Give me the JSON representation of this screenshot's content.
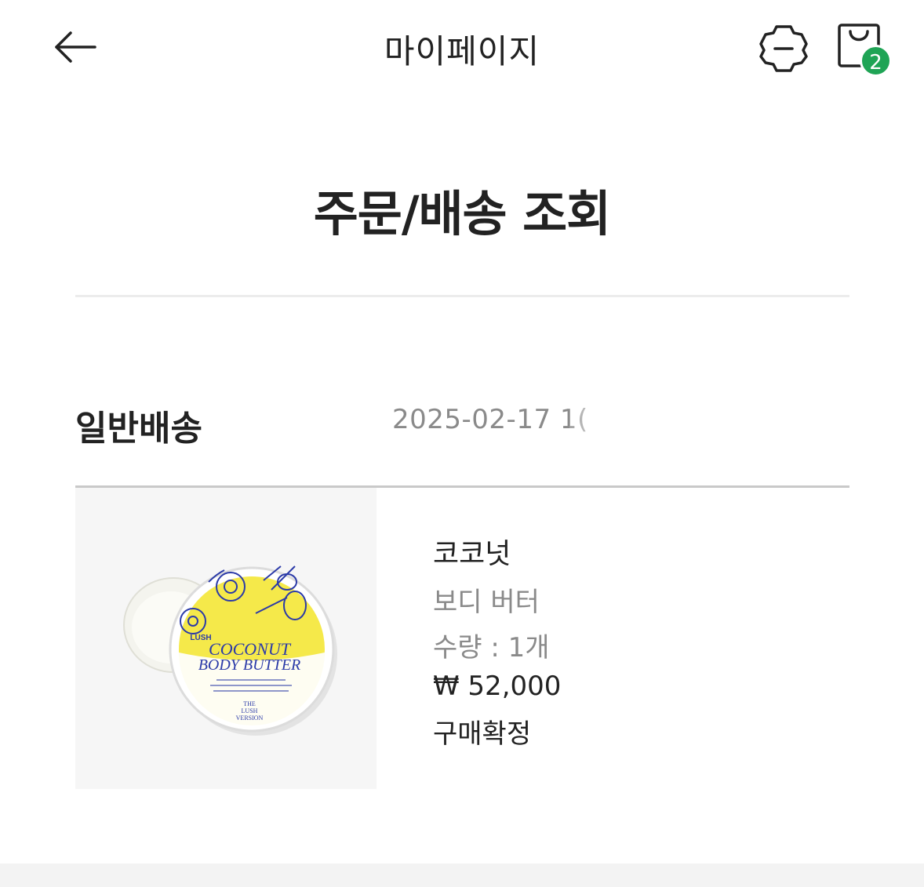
{
  "header": {
    "title": "마이페이지",
    "back_icon": "arrow-left-icon",
    "settings_icon": "gear-icon",
    "bag_icon": "shopping-bag-icon",
    "bag_count": "2",
    "badge_color": "#1fa455"
  },
  "page_title": "주문/배송 조회",
  "order": {
    "shipping_type": "일반배송",
    "date": "2025-02-17 1(",
    "item": {
      "name": "코코넛",
      "subtitle": "보디 버터",
      "quantity": "수량 : 1개",
      "price": "₩ 52,000",
      "status": "구매확정",
      "image": {
        "brand": "LUSH",
        "label_line1": "COCONUT",
        "label_line2": "BODY BUTTER",
        "label_footer1": "THE",
        "label_footer2": "LUSH",
        "label_footer3": "VERSION"
      }
    }
  }
}
